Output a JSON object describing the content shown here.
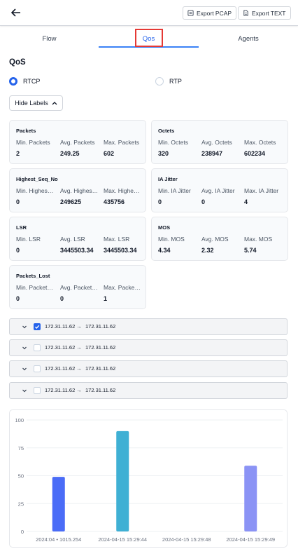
{
  "header": {
    "export_pcap": "Export PCAP",
    "export_text": "Export TEXT"
  },
  "tabs": [
    {
      "label": "Flow"
    },
    {
      "label": "Qos"
    },
    {
      "label": "Agents"
    }
  ],
  "active_tab": "Qos",
  "section_title": "QoS",
  "radios": [
    {
      "label": "RTCP",
      "checked": true
    },
    {
      "label": "RTP",
      "checked": false
    }
  ],
  "hide_labels": "Hide Labels",
  "cards": [
    {
      "title": "Packets",
      "labels": [
        "Min. Packets",
        "Avg. Packets",
        "Max. Packets"
      ],
      "values": [
        "2",
        "249.25",
        "602"
      ]
    },
    {
      "title": "Octets",
      "labels": [
        "Min. Octets",
        "Avg. Octets",
        "Max. Octets"
      ],
      "values": [
        "320",
        "238947",
        "602234"
      ]
    },
    {
      "title": "Highest_Seq_No",
      "labels": [
        "Min. Highes…",
        "Avg. Highes…",
        "Max. Highe…"
      ],
      "values": [
        "0",
        "249625",
        "435756"
      ]
    },
    {
      "title": "IA Jitter",
      "labels": [
        "Min. IA Jitter",
        "Avg. IA Jitter",
        "Max. IA Jitter"
      ],
      "values": [
        "0",
        "0",
        "4"
      ]
    },
    {
      "title": "LSR",
      "labels": [
        "Min. LSR",
        "Avg. LSR",
        "Max. LSR"
      ],
      "values": [
        "0",
        "3445503.34",
        "3445503.34"
      ]
    },
    {
      "title": "MOS",
      "labels": [
        "Min. MOS",
        "Avg. MOS",
        "Max. MOS"
      ],
      "values": [
        "4.34",
        "2.32",
        "5.74"
      ]
    },
    {
      "title": "Packets_Lost",
      "labels": [
        "Min. Packet…",
        "Avg. Packet…",
        "Max. Packe…"
      ],
      "values": [
        "0",
        "0",
        "1"
      ]
    }
  ],
  "flows": [
    {
      "src": "172.31.11.62",
      "dst": "172.31.11.62",
      "checked": true
    },
    {
      "src": "172.31.11.62",
      "dst": "172.31.11.62",
      "checked": false
    },
    {
      "src": "172.31.11.62",
      "dst": "172.31.11.62",
      "checked": false
    },
    {
      "src": "172.31.11.62",
      "dst": "172.31.11.62",
      "checked": false
    }
  ],
  "flow_arrow": "→",
  "chart_data": {
    "type": "bar",
    "categories": [
      "2024:04 • 1015.254",
      "2024-04-15 15:29:44",
      "2024-04-15 15:29:48",
      "2024-04-15 15:29:49"
    ],
    "values": [
      49,
      90,
      0,
      59
    ],
    "colors": [
      "#4a6cf7",
      "#3fb0d4",
      "#6366f1",
      "#8b93f5"
    ],
    "yticks": [
      "0",
      "25",
      "50",
      "75",
      "100"
    ],
    "ylim": [
      0,
      100
    ],
    "grid": true
  },
  "colors": {
    "accent": "#2563eb",
    "highlight": "#e53935"
  }
}
